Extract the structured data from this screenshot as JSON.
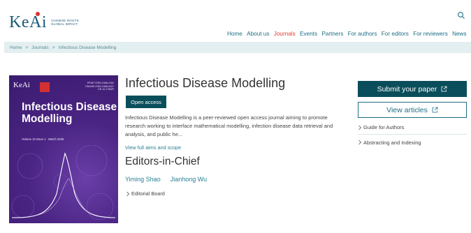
{
  "header": {
    "logo_text": "KeAi",
    "logo_tagline": [
      "CHINESE ROOTS",
      "GLOBAL IMPACT"
    ],
    "nav": [
      {
        "label": "Home",
        "active": false
      },
      {
        "label": "About us",
        "active": false
      },
      {
        "label": "Journals",
        "active": true
      },
      {
        "label": "Events",
        "active": false
      },
      {
        "label": "Partners",
        "active": false
      },
      {
        "label": "For authors",
        "active": false
      },
      {
        "label": "For editors",
        "active": false
      },
      {
        "label": "For reviewers",
        "active": false
      },
      {
        "label": "News",
        "active": false
      }
    ],
    "search_icon": "search-icon"
  },
  "breadcrumb": [
    "Home",
    "Journals",
    "Infectious Disease Modelling"
  ],
  "cover": {
    "logo": "KeAi",
    "issn": [
      "PRINT ISSN 2468-2152",
      "ONLINE ISSN 2468-0427",
      "CN 10-1766/R"
    ],
    "title": "Infectious Disease Modelling",
    "volume": "Volume 10 Issue 1 · March 2025"
  },
  "journal": {
    "title": "Infectious Disease Modelling",
    "badge": "Open access",
    "description": "Infectious Disease Modelling is a peer-reviewed open access journal aiming to promote research working to interface mathematical modelling, infection disease data retrieval and analysis, and public he...",
    "aims_link": "View full aims and scope",
    "eic_heading": "Editors-in-Chief",
    "editors": [
      "Yiming Shao",
      "Jianhong Wu"
    ],
    "board_link": "Editorial Board"
  },
  "sidebar": {
    "submit": "Submit your paper",
    "view": "View articles",
    "links": [
      "Guide for Authors",
      "Abstracting and Indexing"
    ]
  },
  "colors": {
    "accent": "#0a4e5b",
    "link": "#1f6e86",
    "active_nav": "#e03c31",
    "crumb_bg": "#e3eff0",
    "cover_purple": "#4a2483"
  }
}
